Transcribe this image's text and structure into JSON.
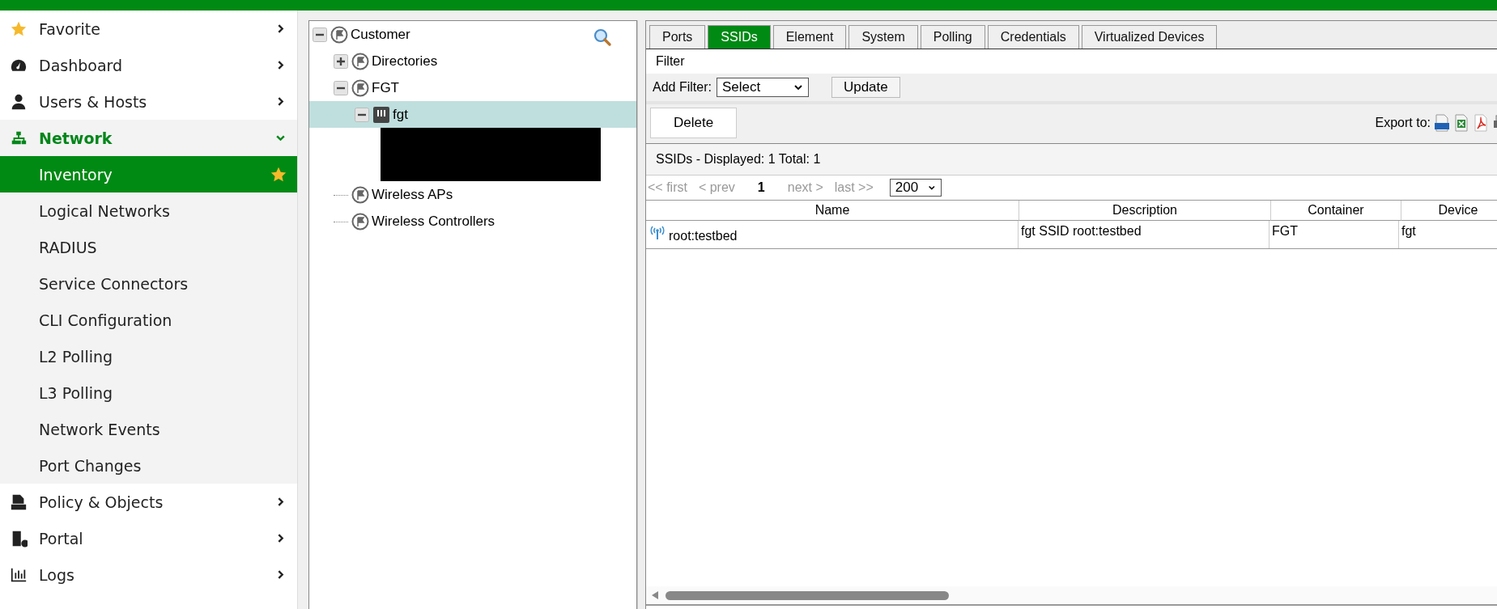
{
  "sidebar": {
    "items": [
      {
        "label": "Favorite",
        "expanded": false
      },
      {
        "label": "Dashboard",
        "expanded": false
      },
      {
        "label": "Users & Hosts",
        "expanded": false
      },
      {
        "label": "Network",
        "expanded": true,
        "children": [
          {
            "label": "Inventory",
            "selected": true
          },
          {
            "label": "Logical Networks",
            "selected": false
          },
          {
            "label": "RADIUS",
            "selected": false
          },
          {
            "label": "Service Connectors",
            "selected": false
          },
          {
            "label": "CLI Configuration",
            "selected": false
          },
          {
            "label": "L2 Polling",
            "selected": false
          },
          {
            "label": "L3 Polling",
            "selected": false
          },
          {
            "label": "Network Events",
            "selected": false
          },
          {
            "label": "Port Changes",
            "selected": false
          }
        ]
      },
      {
        "label": "Policy & Objects",
        "expanded": false
      },
      {
        "label": "Portal",
        "expanded": false
      },
      {
        "label": "Logs",
        "expanded": false
      }
    ]
  },
  "tree": [
    {
      "label": "Customer",
      "kind": "group",
      "expanded": true,
      "selected": false,
      "children": [
        {
          "label": "Directories",
          "kind": "group",
          "expanded": false,
          "selected": false
        },
        {
          "label": "FGT",
          "kind": "group",
          "expanded": true,
          "selected": false,
          "children": [
            {
              "label": "fgt",
              "kind": "device",
              "expanded": true,
              "selected": true
            }
          ]
        },
        {
          "label": "Wireless APs",
          "kind": "group",
          "selected": false
        },
        {
          "label": "Wireless Controllers",
          "kind": "group",
          "selected": false
        }
      ]
    }
  ],
  "tabs": [
    {
      "label": "Ports",
      "selected": false
    },
    {
      "label": "SSIDs",
      "selected": true
    },
    {
      "label": "Element",
      "selected": false
    },
    {
      "label": "System",
      "selected": false
    },
    {
      "label": "Polling",
      "selected": false
    },
    {
      "label": "Credentials",
      "selected": false
    },
    {
      "label": "Virtualized Devices",
      "selected": false
    }
  ],
  "filter": {
    "title": "Filter",
    "add_label": "Add Filter:",
    "select_value": "Select",
    "update_button": "Update"
  },
  "delete_button": "Delete",
  "export_label": "Export to:",
  "summary": "SSIDs - Displayed: 1 Total: 1",
  "pager": {
    "first": "<< first",
    "prev": "< prev",
    "page": "1",
    "next": "next >",
    "last": "last >>",
    "page_size": "200"
  },
  "table": {
    "columns": [
      "Name",
      "Description",
      "Container",
      "Device"
    ],
    "rows": [
      {
        "cells": [
          "root:testbed",
          "fgt SSID root:testbed",
          "FGT",
          "fgt"
        ]
      }
    ]
  }
}
